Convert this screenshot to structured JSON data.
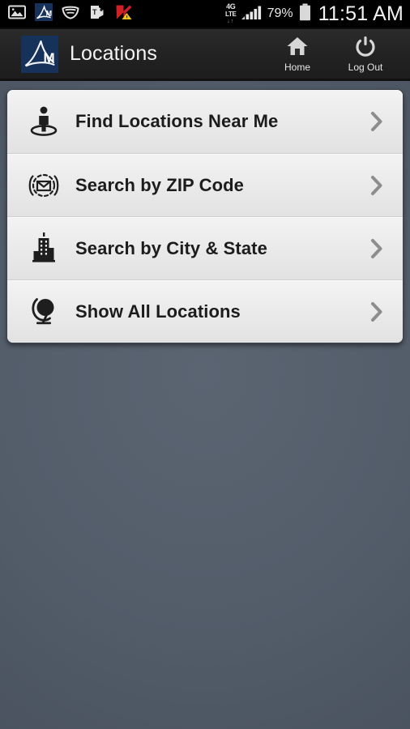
{
  "status_bar": {
    "left_icons": [
      {
        "name": "gallery-image-icon",
        "label": "image"
      },
      {
        "name": "app-notification-icon",
        "label": "AM app"
      },
      {
        "name": "shield-vpn-icon",
        "label": "shield"
      },
      {
        "name": "tmobile-key-icon",
        "label": "key"
      },
      {
        "name": "antivirus-alert-icon",
        "label": "antivirus"
      }
    ],
    "network_type": "4G",
    "network_subtype": "LTE",
    "data_arrows": "↓↑",
    "signal_icon": "signal-bars-icon",
    "battery_percent": "79%",
    "battery_icon": "battery-icon",
    "clock": "11:51 AM"
  },
  "app_bar": {
    "logo_name": "am-logo-icon",
    "logo_letter": "M",
    "title": "Locations",
    "actions": [
      {
        "label": "Home",
        "icon": "home-icon",
        "name": "home-button"
      },
      {
        "label": "Log Out",
        "icon": "power-icon",
        "name": "log-out-button"
      }
    ]
  },
  "menu": {
    "items": [
      {
        "label": "Find Locations Near Me",
        "icon": "person-location-icon",
        "name": "menu-item-find-near-me"
      },
      {
        "label": "Search by ZIP Code",
        "icon": "envelope-zip-icon",
        "name": "menu-item-search-zip"
      },
      {
        "label": "Search by City & State",
        "icon": "city-building-icon",
        "name": "menu-item-search-city-state"
      },
      {
        "label": "Show All Locations",
        "icon": "globe-icon",
        "name": "menu-item-show-all"
      }
    ],
    "chevron_icon": "chevron-right-icon"
  },
  "colors": {
    "background": "#545e6b",
    "app_bar": "#222222",
    "status_bar": "#000000",
    "brand_navy": "#16315a",
    "row_text": "#1c1c1c",
    "chevron": "#8d8d8d"
  }
}
